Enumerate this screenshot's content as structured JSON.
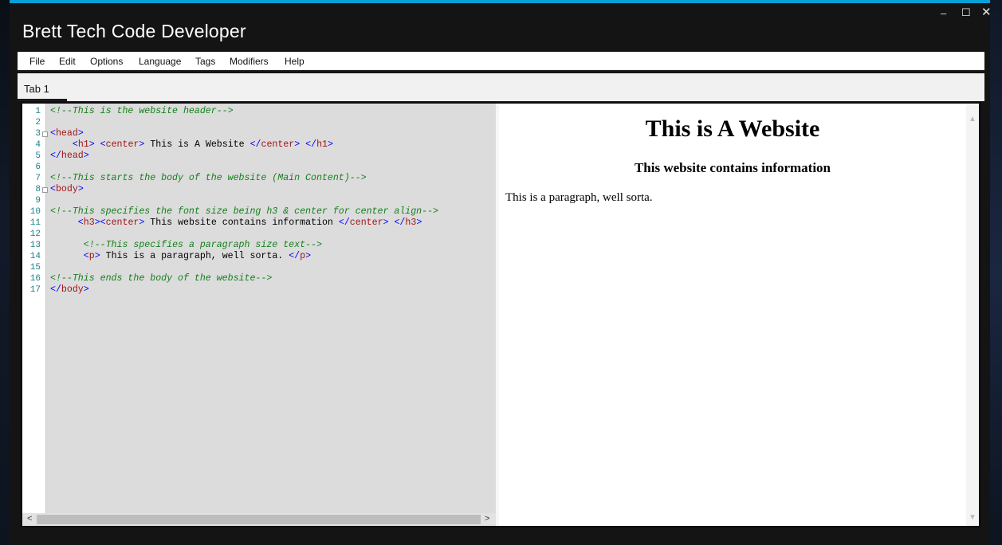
{
  "window": {
    "title": "Brett Tech Code Developer",
    "minimize_glyph": "‒",
    "maximize_glyph": "☐",
    "close_glyph": "✕",
    "accent_color": "#0aa0d6"
  },
  "menu": [
    "File",
    "Edit",
    "Options",
    "Language",
    "Tags",
    "Modifiers",
    "Help"
  ],
  "tabs": [
    {
      "label": "Tab 1",
      "active": true
    }
  ],
  "editor": {
    "line_numbers": [
      "1",
      "2",
      "3",
      "4",
      "5",
      "6",
      "7",
      "8",
      "9",
      "10",
      "11",
      "12",
      "13",
      "14",
      "15",
      "16",
      "17"
    ],
    "lines": [
      "<!--This is the website header-->",
      "",
      "<head>",
      "    <h1> <center> This is A Website </center> </h1>",
      "</head>",
      "",
      "<!--This starts the body of the website (Main Content)-->",
      "<body>",
      "",
      "<!--This specifies the font size being h3 & center for center align-->",
      "     <h3><center> This website contains information </center> </h3>",
      "",
      "      <!--This specifies a paragraph size text-->",
      "      <p> This is a paragraph, well sorta. </p>",
      "",
      "<!--This ends the body of the website-->",
      "</body>"
    ],
    "scroll_left_glyph": "<",
    "scroll_right_glyph": ">"
  },
  "preview": {
    "h1": "This is A Website",
    "h3": "This website contains information",
    "p": "This is a paragraph, well sorta.",
    "scroll_up_glyph": "▲",
    "scroll_down_glyph": "▼"
  }
}
